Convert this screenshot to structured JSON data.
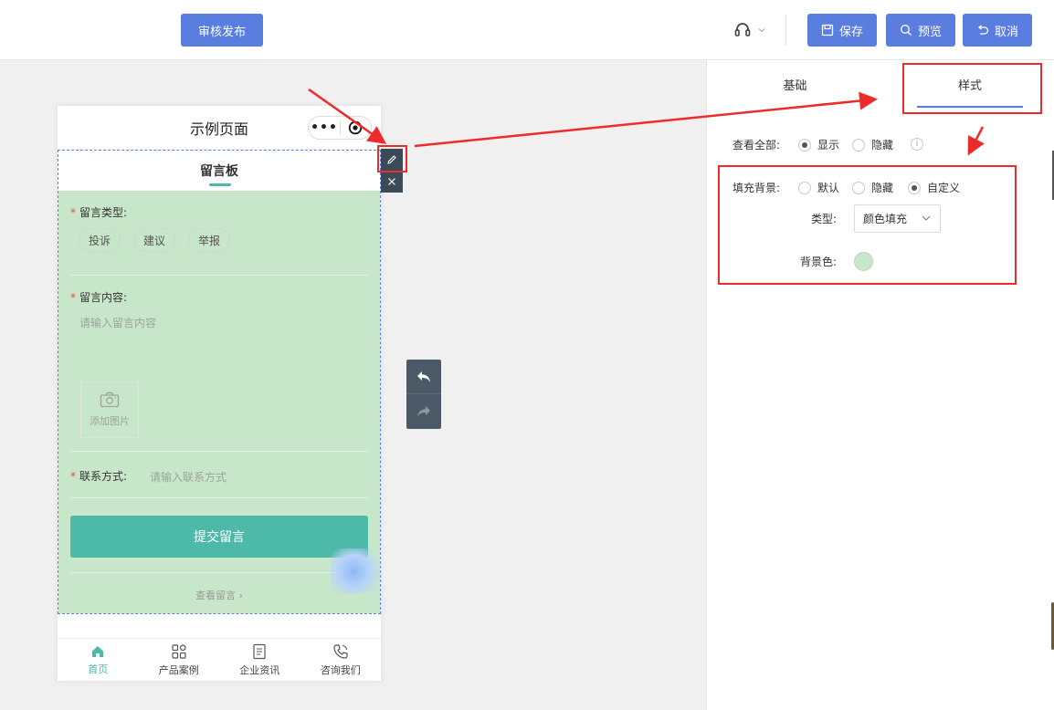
{
  "toolbar": {
    "publish_label": "审核发布",
    "save_label": "保存",
    "preview_label": "预览",
    "cancel_label": "取消",
    "accent_color": "#5a7de0"
  },
  "phone": {
    "page_title": "示例页面",
    "capsule_more": "•••",
    "module_title": "留言板",
    "form": {
      "type_label": "留言类型:",
      "type_options": [
        "投诉",
        "建议",
        "举报"
      ],
      "content_label": "留言内容:",
      "content_placeholder": "请输入留言内容",
      "add_photo_label": "添加图片",
      "contact_label": "联系方式:",
      "contact_placeholder": "请输入联系方式",
      "submit_label": "提交留言",
      "view_messages": "查看留言 ›"
    },
    "tabbar": [
      {
        "label": "首页",
        "icon": "home-icon",
        "active": true
      },
      {
        "label": "产品案例",
        "icon": "grid-icon",
        "active": false
      },
      {
        "label": "企业资讯",
        "icon": "document-icon",
        "active": false
      },
      {
        "label": "咨询我们",
        "icon": "phone-icon",
        "active": false
      }
    ],
    "module_bg_color": "#c8e6c9",
    "submit_color": "#4db9a9"
  },
  "panel": {
    "tabs": [
      "基础",
      "样式"
    ],
    "active_tab": "样式",
    "view_all_label": "查看全部:",
    "view_all_options": [
      "显示",
      "隐藏"
    ],
    "view_all_selected": "显示",
    "fill_bg_label": "填充背景:",
    "fill_bg_options": [
      "默认",
      "隐藏",
      "自定义"
    ],
    "fill_bg_selected": "自定义",
    "type_label": "类型:",
    "type_value": "颜色填充",
    "bg_color_label": "背景色:",
    "bg_color_value": "#c8e6c9"
  }
}
